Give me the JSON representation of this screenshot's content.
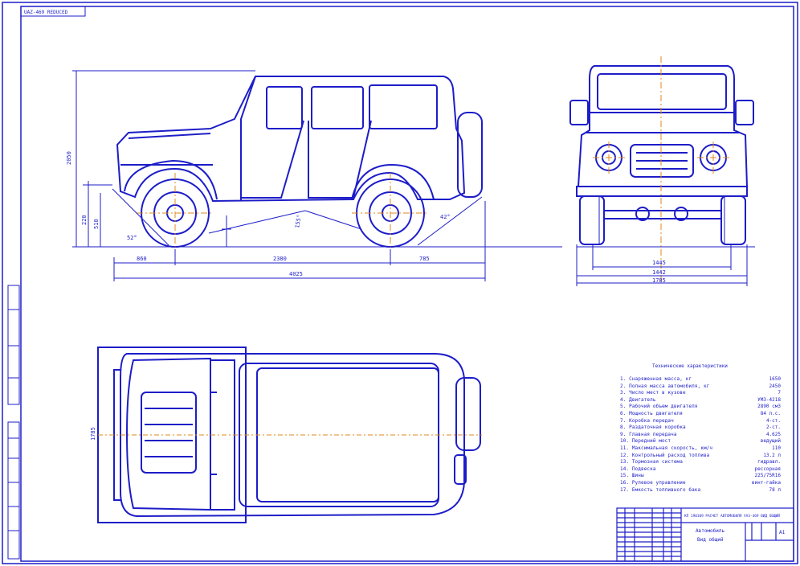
{
  "sheet": {
    "corner_stamp": "UAZ-469 REDUCED"
  },
  "dimensions": {
    "overall_length": "4025",
    "wheelbase": "2380",
    "front_overhang": "860",
    "rear_overhang": "785",
    "height": "2050",
    "ground_clearance": "220",
    "wheel_height": "510",
    "front_track": "1445",
    "rear_track": "1442",
    "overall_width": "1785",
    "plan_width": "1785",
    "approach_angle": "52°",
    "departure_angle": "42°",
    "ramp_angle": "155°"
  },
  "spec_table": {
    "title": "Технические характеристики",
    "rows": [
      {
        "name": "1. Снаряженная масса, кг",
        "value": "1650"
      },
      {
        "name": "2. Полная масса автомобиля, кг",
        "value": "2450"
      },
      {
        "name": "3. Число мест в кузове",
        "value": "7"
      },
      {
        "name": "4. Двигатель",
        "value": "УМЗ-4218"
      },
      {
        "name": "5. Рабочий объем двигателя",
        "value": "2890 см3"
      },
      {
        "name": "6. Мощность двигателя",
        "value": "84 л.с."
      },
      {
        "name": "7. Коробка передач",
        "value": "4-ст."
      },
      {
        "name": "8. Раздаточная коробка",
        "value": "2-ст."
      },
      {
        "name": "9. Главная передача",
        "value": "4.625"
      },
      {
        "name": "10. Передний мост",
        "value": "ведущий"
      },
      {
        "name": "11. Максимальная скорость, км/ч",
        "value": "110"
      },
      {
        "name": "12. Контрольный расход топлива",
        "value": "13.2 л"
      },
      {
        "name": "13. Тормозная система",
        "value": "гидравл."
      },
      {
        "name": "14. Подвеска",
        "value": "рессорная"
      },
      {
        "name": "15. Шины",
        "value": "225/75R16"
      },
      {
        "name": "16. Рулевое управление",
        "value": "винт-гайка"
      },
      {
        "name": "17. Емкость топливного бака",
        "value": "78 л"
      }
    ]
  },
  "title_block": {
    "document_code": "КП 190109 РАСЧЕТ АВТОМОБИЛЯ УАЗ-469 ВИД ОБЩИЙ",
    "drawing_name_line1": "Автомобиль",
    "drawing_name_line2": "Вид общий",
    "sheet_format": "А1"
  },
  "colors": {
    "line": "#1d1dc8",
    "axis": "#e08a1c",
    "border": "#1d1dc8",
    "background": "#ffffff"
  }
}
